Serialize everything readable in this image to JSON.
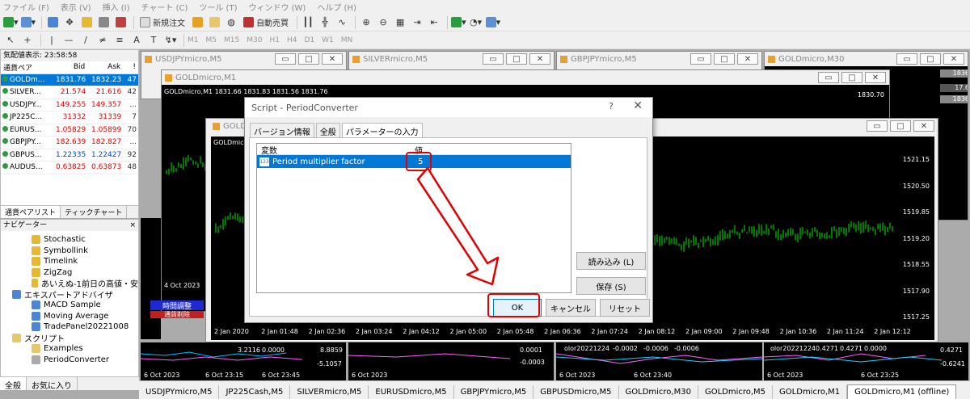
{
  "menu": [
    "ファイル (F)",
    "表示 (V)",
    "挿入 (I)",
    "チャート (C)",
    "ツール (T)",
    "ウィンドウ (W)",
    "ヘルプ (H)"
  ],
  "toolbar": {
    "new_order": "新規注文",
    "auto_trade": "自動売買",
    "timeframes": [
      "M1",
      "M5",
      "M15",
      "M30",
      "H1",
      "H4",
      "D1",
      "W1",
      "MN"
    ]
  },
  "market_watch": {
    "header": "気配値表示: 23:58:58",
    "columns": [
      "通貨ペア",
      "Bid",
      "Ask",
      "!"
    ],
    "rows": [
      {
        "symbol": "GOLDm...",
        "bid": "1831.76",
        "ask": "1832.23",
        "spread": "47"
      },
      {
        "symbol": "SILVER...",
        "bid": "21.574",
        "ask": "21.616",
        "spread": "42"
      },
      {
        "symbol": "USDJPY...",
        "bid": "149.255",
        "ask": "149.357",
        "spread": "..."
      },
      {
        "symbol": "JP225C...",
        "bid": "31332",
        "ask": "31339",
        "spread": "7"
      },
      {
        "symbol": "EURUS...",
        "bid": "1.05829",
        "ask": "1.05899",
        "spread": "70"
      },
      {
        "symbol": "GBPJPY...",
        "bid": "182.639",
        "ask": "182.827",
        "spread": "..."
      },
      {
        "symbol": "GBPUS...",
        "bid": "1.22335",
        "ask": "1.22427",
        "spread": "92"
      },
      {
        "symbol": "AUDUS...",
        "bid": "0.63825",
        "ask": "0.63873",
        "spread": "48"
      }
    ],
    "tabs": [
      "通貨ペアリスト",
      "ティックチャート"
    ]
  },
  "navigator": {
    "header": "ナビゲーター",
    "close": "×",
    "items": [
      {
        "label": "Stochastic",
        "indent": 2,
        "kind": "ind"
      },
      {
        "label": "Symbollink",
        "indent": 2,
        "kind": "ind"
      },
      {
        "label": "Timelink",
        "indent": 2,
        "kind": "ind"
      },
      {
        "label": "ZigZag",
        "indent": 2,
        "kind": "ind"
      },
      {
        "label": "あいえぬ-1前日の高値・安",
        "indent": 2,
        "kind": "ind"
      },
      {
        "label": "エキスパートアドバイザ",
        "indent": 1,
        "kind": "gear"
      },
      {
        "label": "MACD Sample",
        "indent": 2,
        "kind": "gear"
      },
      {
        "label": "Moving Average",
        "indent": 2,
        "kind": "gear"
      },
      {
        "label": "TradePanel20221008",
        "indent": 2,
        "kind": "gear"
      },
      {
        "label": "スクリプト",
        "indent": 1,
        "kind": "folder"
      },
      {
        "label": "Examples",
        "indent": 2,
        "kind": "folder"
      },
      {
        "label": "PeriodConverter",
        "indent": 2,
        "kind": "gray"
      }
    ],
    "tabs": [
      "全般",
      "お気に入り"
    ]
  },
  "windows": {
    "usdjpy": "USDJPYmicro,M5",
    "silver": "SILVERmicro,M5",
    "gbpjpy": "GBPJPYmicro,M5",
    "gold_m30": "GOLDmicro,M30",
    "gold_m1": "GOLDmicro,M1",
    "gold_m1_info": "GOLDmicro,M1 1831.66 1831.83 1831.56 1831.76",
    "gold_m1_price": "1830.70",
    "gold_m1_date": "4 Oct 2023",
    "offline_title": "GOLD",
    "offline_info": "GOLDmic",
    "gold_m30_prices": [
      "1836",
      "17.6",
      "1836"
    ],
    "panel_buttons": [
      "時間調整",
      "通貨削除"
    ]
  },
  "offline_chart": {
    "prices": [
      "1521.15",
      "1520.50",
      "1519.85",
      "1519.20",
      "1518.55",
      "1517.90",
      "1517.25"
    ],
    "times": [
      "2 Jan 2020",
      "2 Jan 01:48",
      "2 Jan 02:36",
      "2 Jan 03:24",
      "2 Jan 04:12",
      "2 Jan 05:00",
      "2 Jan 05:48",
      "2 Jan 06:36",
      "2 Jan 07:24",
      "2 Jan 08:12",
      "2 Jan 09:00",
      "2 Jan 09:48",
      "2 Jan 10:36",
      "2 Jan 11:24",
      "2 Jan 12:12"
    ]
  },
  "bottom_strips": {
    "a": [
      "3.2116",
      "0.0000",
      "8.8859",
      "-5.1057"
    ],
    "b": [
      "0.0001",
      "-0.0003"
    ],
    "c": [
      "olor20221224",
      "-0.0002",
      "-0.0006",
      "-0.0006"
    ],
    "d": [
      "olor20221224",
      "0.4271",
      "0.4271",
      "0.0000"
    ],
    "d_right": [
      "0.4271",
      "-0.6241"
    ],
    "dates_a": [
      "6 Oct 2023",
      "6 Oct 23:15",
      "6 Oct 23:45"
    ],
    "dates_b": [
      "6 Oct 2023"
    ],
    "dates_c": [
      "6 Oct 2023",
      "6 Oct 23:40"
    ],
    "dates_d": [
      "6 Oct 2023",
      "6 Oct 23:25"
    ]
  },
  "taskbar": [
    "USDJPYmicro,M5",
    "JP225Cash,M5",
    "SILVERmicro,M5",
    "EURUSDmicro,M5",
    "GBPJPYmicro,M5",
    "GBPUSDmicro,M5",
    "GOLDmicro,M30",
    "GOLDmicro,M5",
    "GOLDmicro,M1",
    "GOLDmicro,M1 (offline)"
  ],
  "dialog": {
    "title": "Script - PeriodConverter",
    "help": "?",
    "close": "✕",
    "tabs": [
      "バージョン情報",
      "全般",
      "パラメーターの入力"
    ],
    "col_variable": "変数",
    "col_value": "値",
    "param_name": "Period multiplier factor",
    "param_icon_text": "123",
    "param_value": "5",
    "load": "読み込み (L)",
    "save": "保存 (S)",
    "ok": "OK",
    "cancel": "キャンセル",
    "reset": "リセット"
  },
  "colors": {
    "highlight": "#0078d7",
    "annotation": "#e00000",
    "candle": "#00c800"
  }
}
